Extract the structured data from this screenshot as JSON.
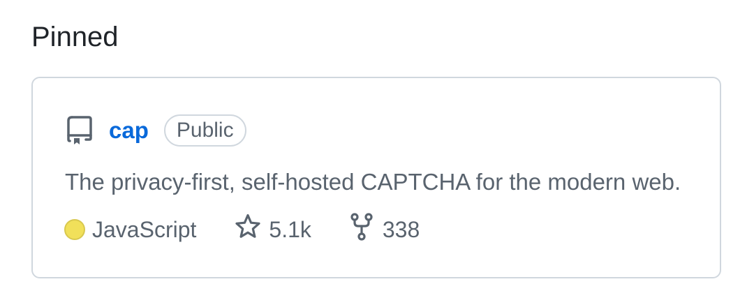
{
  "section": {
    "title": "Pinned"
  },
  "card": {
    "repo_name": "cap",
    "visibility": "Public",
    "description": "The privacy-first, self-hosted CAPTCHA for the modern web.",
    "language": {
      "name": "JavaScript",
      "color": "#f1e05a"
    },
    "stars": "5.1k",
    "forks": "338",
    "icons": {
      "repo": "repo-icon",
      "star": "star-icon",
      "fork": "fork-icon"
    },
    "colors": {
      "link": "#0969da",
      "muted": "#59636e",
      "border": "#d0d7de"
    }
  }
}
